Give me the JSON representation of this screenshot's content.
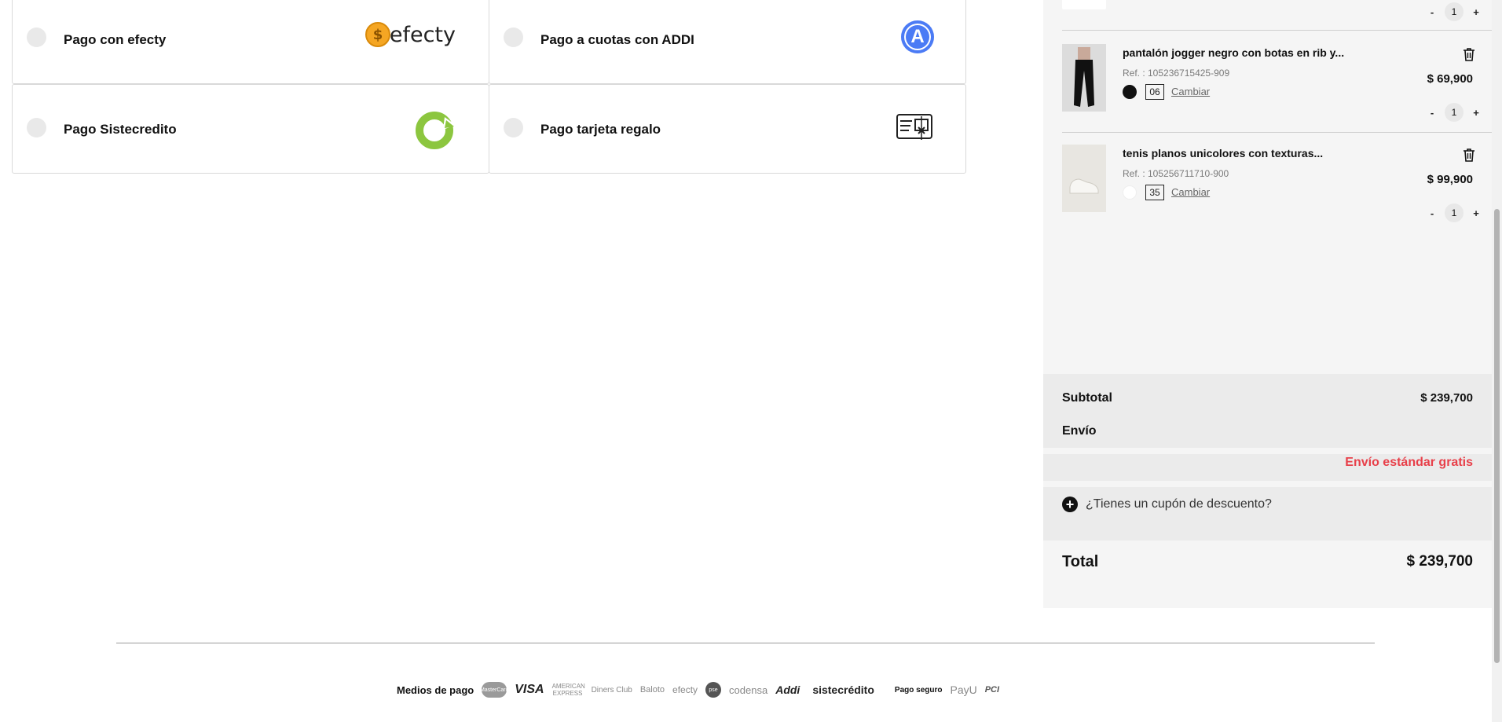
{
  "payment_options": [
    {
      "label": "Pago con efecty",
      "logo_text": "efecty",
      "logo": "efecty-logo"
    },
    {
      "label": "Pago a cuotas con ADDI",
      "logo_text": "A",
      "logo": "addi-logo"
    },
    {
      "label": "Pago Sistecredito",
      "logo": "sistecredito-logo"
    },
    {
      "label": "Pago tarjeta regalo",
      "logo": "gift-card-icon"
    }
  ],
  "cart": {
    "items": [
      {
        "title": "pantalón jogger negro con botas en rib y...",
        "ref": "Ref. : 105236715425-909",
        "color": "#111111",
        "size": "06",
        "change_label": "Cambiar",
        "price": "$ 69,900",
        "qty": "1"
      },
      {
        "title": "tenis planos unicolores con texturas...",
        "ref": "Ref. : 105256711710-900",
        "color": "#ffffff",
        "size": "35",
        "change_label": "Cambiar",
        "price": "$ 99,900",
        "qty": "1"
      }
    ],
    "top_qty": "1",
    "qty_minus": "-",
    "qty_plus": "+"
  },
  "summary": {
    "subtotal_label": "Subtotal",
    "subtotal_value": "$ 239,700",
    "shipping_label": "Envío",
    "shipping_value": "Envío estándar gratis",
    "coupon_label": "¿Tienes un cupón de descuento?",
    "total_label": "Total",
    "total_value": "$ 239,700"
  },
  "footer": {
    "payment_methods_label": "Medios de pago",
    "logos": [
      "MasterCard",
      "VISA",
      "AMERICAN EXPRESS",
      "Diners Club",
      "Baloto",
      "efecty",
      "pse",
      "codensa",
      "Addi",
      "sistecrédito"
    ],
    "secure_label": "Pago seguro",
    "secure_logos": [
      "PayU",
      "PCI"
    ]
  },
  "colors": {
    "accent_red": "#e8404a",
    "addi_blue": "#4b7bf5",
    "sistecredito_green": "#8cc63f",
    "efecty_orange": "#f5a623"
  }
}
